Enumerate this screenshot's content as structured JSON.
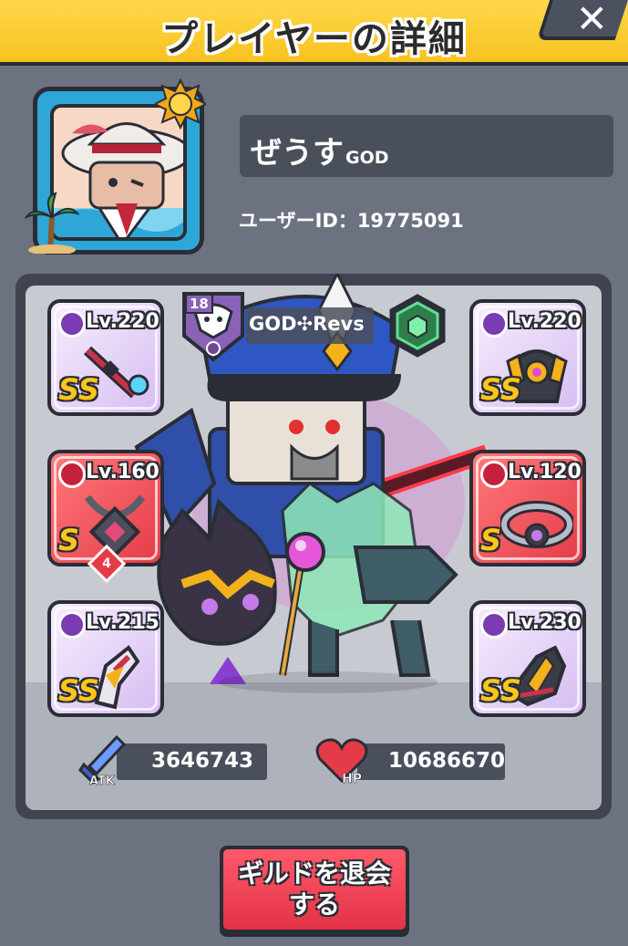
{
  "header": {
    "title": "プレイヤーの詳細",
    "close_label": "✕"
  },
  "player": {
    "name": "ぜうす",
    "title_tag": "GOD",
    "user_id_label": "ユーザーID：19775091"
  },
  "guild": {
    "level": "18",
    "name": "GOD✣Revs"
  },
  "equipment": [
    {
      "slot": "weapon",
      "level": "Lv.220",
      "rank": "SS",
      "type_icon": "sword-type-icon"
    },
    {
      "slot": "necklace",
      "level": "Lv.160",
      "rank": "S",
      "stars": "4",
      "type_icon": "necklace-type-icon"
    },
    {
      "slot": "gloves",
      "level": "Lv.215",
      "rank": "SS",
      "type_icon": "glove-type-icon"
    },
    {
      "slot": "armor",
      "level": "Lv.220",
      "rank": "SS",
      "type_icon": "armor-type-icon"
    },
    {
      "slot": "belt",
      "level": "Lv.120",
      "rank": "S",
      "type_icon": "belt-type-icon"
    },
    {
      "slot": "boots",
      "level": "Lv.230",
      "rank": "SS",
      "type_icon": "boot-type-icon"
    }
  ],
  "stats": {
    "atk_label": "ATK",
    "atk_value": "3646743",
    "hp_label": "HP",
    "hp_value": "10686670"
  },
  "leave_button": {
    "line1": "ギルドを退会",
    "line2": "する"
  },
  "colors": {
    "header_yellow": "#f6c21f",
    "ss_slot_purple": "#d6bdf2",
    "s_slot_red": "#e53b48",
    "button_red": "#e23247"
  }
}
